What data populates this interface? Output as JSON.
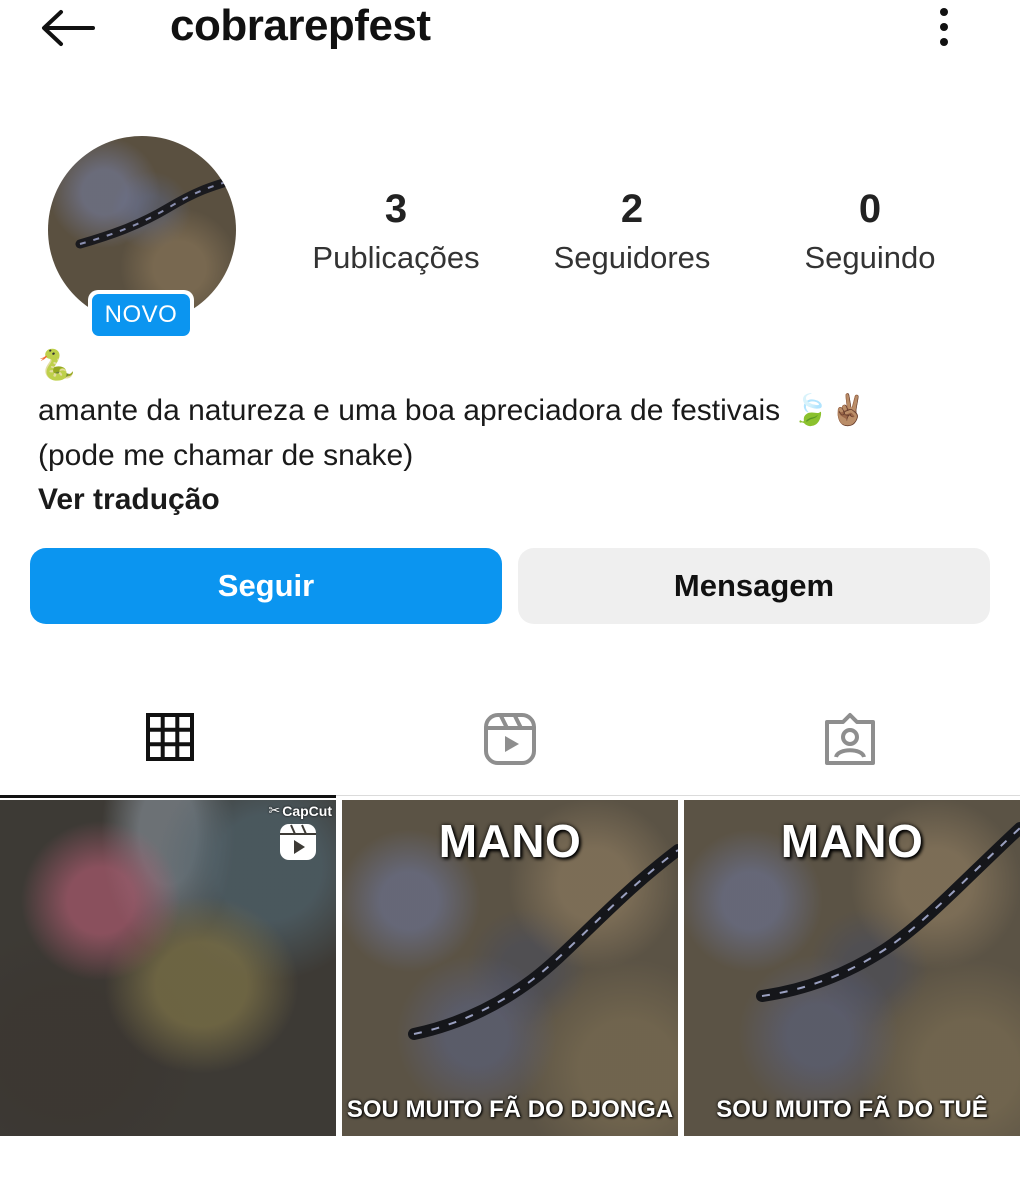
{
  "header": {
    "username": "cobrarepfest",
    "back_icon": "arrow-left-icon",
    "more_icon": "more-vertical-icon"
  },
  "profile": {
    "badge": "NOVO",
    "stats": [
      {
        "value": "3",
        "label": "Publicações"
      },
      {
        "value": "2",
        "label": "Seguidores"
      },
      {
        "value": "0",
        "label": "Seguindo"
      }
    ],
    "bio_emoji": "🐍",
    "bio_line1": "amante da natureza e uma boa apreciadora de festivais",
    "bio_line1_emojis": "🍃✌🏽",
    "bio_line2": "(pode me chamar de snake)",
    "translate_link": "Ver tradução"
  },
  "actions": {
    "follow_label": "Seguir",
    "message_label": "Mensagem"
  },
  "tabs": [
    {
      "icon": "grid-icon",
      "active": true
    },
    {
      "icon": "reels-icon",
      "active": false
    },
    {
      "icon": "tagged-icon",
      "active": false
    }
  ],
  "posts": [
    {
      "type": "reel",
      "watermark": "CapCut"
    },
    {
      "top_text": "MANO",
      "bottom_text": "SOU MUITO FÃ DO DJONGA"
    },
    {
      "top_text": "MANO",
      "bottom_text": "SOU MUITO FÃ DO TUÊ"
    }
  ],
  "colors": {
    "accent": "#0b95f0",
    "secondary_button": "#efefef",
    "text": "#111111"
  }
}
